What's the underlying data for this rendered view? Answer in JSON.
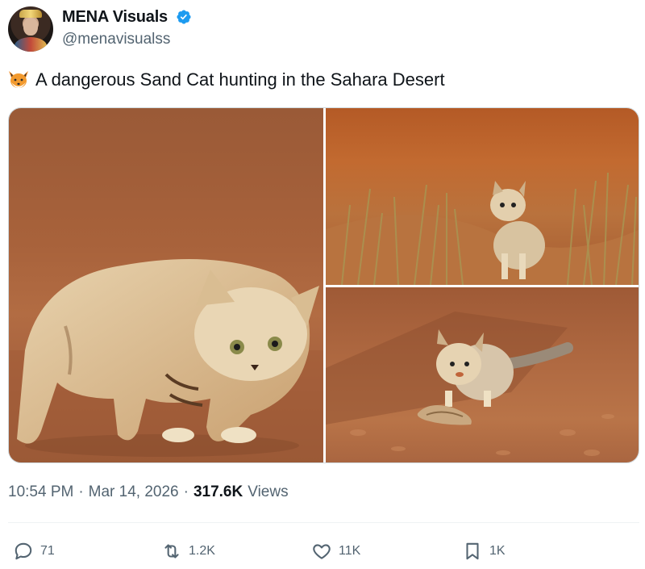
{
  "author": {
    "display_name": "MENA Visuals",
    "handle": "@menavisualss",
    "verified": true,
    "avatar_icon": "avatar-portrait",
    "verified_color": "#1d9bf0"
  },
  "tweet": {
    "emoji_icon": "fox-face-icon",
    "text": "A dangerous Sand Cat hunting in the Sahara Desert"
  },
  "media": [
    {
      "name": "photo-sand-cat-stalking"
    },
    {
      "name": "photo-sand-cat-in-grass"
    },
    {
      "name": "photo-sand-cat-with-snake"
    }
  ],
  "meta": {
    "time": "10:54 PM",
    "sep1": "·",
    "date": "Mar 14, 2026",
    "sep2": "·",
    "views_count": "317.6K",
    "views_label": "Views"
  },
  "actions": {
    "reply_count": "71",
    "retweet_count": "1.2K",
    "like_count": "11K",
    "bookmark_count": "1K"
  },
  "colors": {
    "text_primary": "#0f1419",
    "text_secondary": "#536471",
    "border": "#cfd9de"
  }
}
